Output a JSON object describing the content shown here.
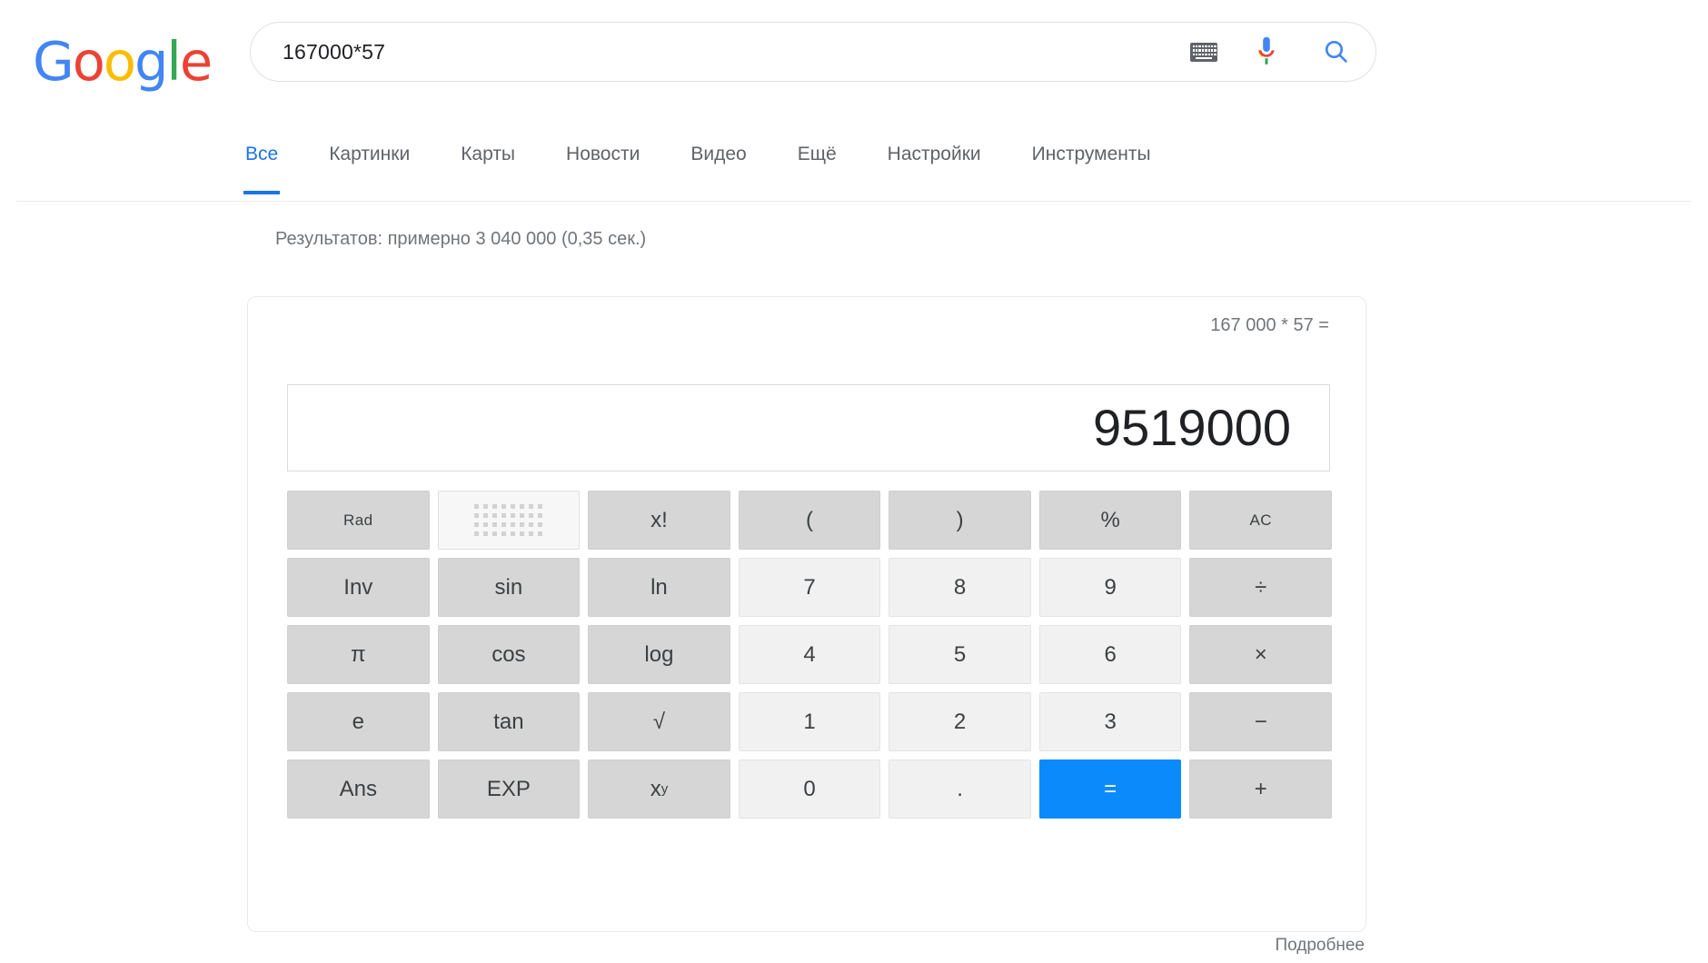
{
  "brand": {
    "name": "Google",
    "letters": [
      {
        "ch": "G",
        "color": "#4285F4"
      },
      {
        "ch": "o",
        "color": "#EA4335"
      },
      {
        "ch": "o",
        "color": "#FBBC05"
      },
      {
        "ch": "g",
        "color": "#4285F4"
      },
      {
        "ch": "l",
        "color": "#34A853"
      },
      {
        "ch": "e",
        "color": "#EA4335"
      }
    ]
  },
  "search": {
    "query": "167000*57",
    "placeholder": "",
    "keyboard_icon": "keyboard-icon",
    "mic_icon": "microphone-icon",
    "search_icon": "search-icon"
  },
  "nav": {
    "tabs": [
      {
        "label": "Все",
        "active": true
      },
      {
        "label": "Картинки",
        "active": false
      },
      {
        "label": "Карты",
        "active": false
      },
      {
        "label": "Новости",
        "active": false
      },
      {
        "label": "Видео",
        "active": false
      },
      {
        "label": "Ещё",
        "active": false
      },
      {
        "label": "Настройки",
        "active": false
      },
      {
        "label": "Инструменты",
        "active": false
      }
    ]
  },
  "results": {
    "stats": "Результатов: примерно 3 040 000 (0,35 сек.)"
  },
  "calculator": {
    "expression": "167 000 * 57 =",
    "result": "9519000",
    "keys": {
      "r1": [
        "Rad",
        "",
        "x!",
        "(",
        ")",
        "%",
        "AC"
      ],
      "r2": [
        "Inv",
        "sin",
        "ln",
        "7",
        "8",
        "9",
        "÷"
      ],
      "r3": [
        "π",
        "cos",
        "log",
        "4",
        "5",
        "6",
        "×"
      ],
      "r4": [
        "e",
        "tan",
        "√",
        "1",
        "2",
        "3",
        "−"
      ],
      "r5": [
        "Ans",
        "EXP",
        "x",
        "0",
        ".",
        "=",
        "+"
      ],
      "xy_exponent": "y",
      "keypad_toggle_icon": "keypad-grid-icon"
    },
    "accent_color": "#0b8afc",
    "fn_key_color": "#d6d6d6",
    "num_key_color": "#f1f1f1"
  },
  "footer": {
    "more_label": "Подробнее"
  }
}
